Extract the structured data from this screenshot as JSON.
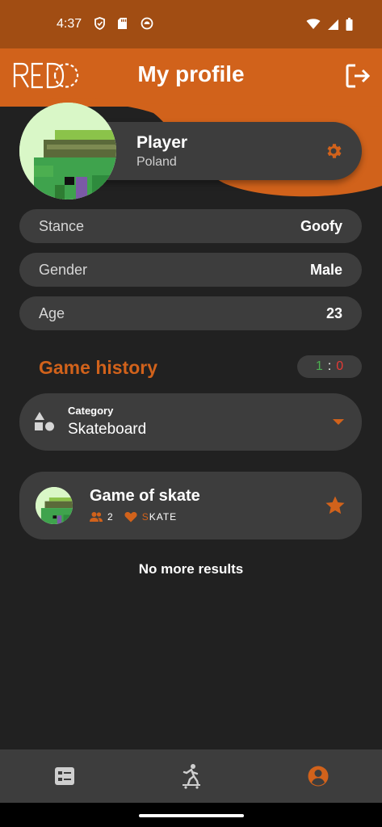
{
  "status_bar": {
    "time": "4:37"
  },
  "header": {
    "logo_text": "REDO",
    "title": "My profile"
  },
  "profile": {
    "name": "Player",
    "country": "Poland",
    "details": [
      {
        "label": "Stance",
        "value": "Goofy"
      },
      {
        "label": "Gender",
        "value": "Male"
      },
      {
        "label": "Age",
        "value": "23"
      }
    ]
  },
  "history": {
    "title": "Game history",
    "score": {
      "wins": "1",
      "separator": ":",
      "losses": "0"
    },
    "category": {
      "label": "Category",
      "value": "Skateboard"
    },
    "games": [
      {
        "title": "Game of skate",
        "players": "2",
        "word_highlight": "S",
        "word_rest": "KATE"
      }
    ],
    "end_text": "No more results"
  },
  "colors": {
    "accent": "#d1621b",
    "status_bar": "#a14d13",
    "background": "#212121",
    "card": "#3d3d3d",
    "win": "#4caf50",
    "loss": "#e53935"
  },
  "icons": {
    "status": [
      "shield-icon",
      "sd-card-icon",
      "sync-icon",
      "wifi-icon",
      "signal-icon",
      "battery-icon"
    ],
    "logout": "logout-icon",
    "settings": "gear-icon",
    "category": "shapes-icon",
    "players": "people-icon",
    "likes": "heart-icon",
    "favorite": "star-icon",
    "nav": [
      "dashboard-icon",
      "skateboarder-icon",
      "account-icon"
    ]
  }
}
